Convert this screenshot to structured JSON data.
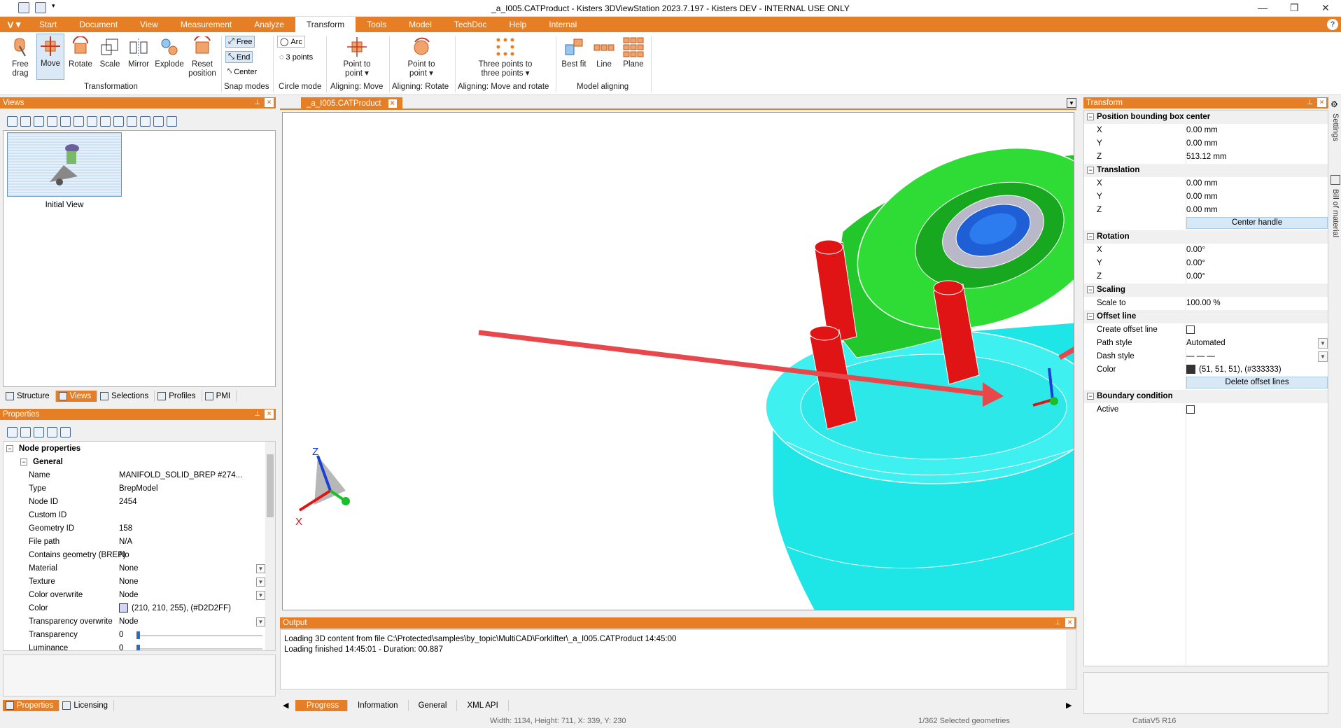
{
  "window": {
    "title": "_a_I005.CATProduct - Kisters 3DViewStation 2023.7.197 - Kisters DEV - INTERNAL USE ONLY",
    "min": "—",
    "max": "❐",
    "close": "✕"
  },
  "menu": {
    "logo": "V",
    "tabs": [
      "Start",
      "Document",
      "View",
      "Measurement",
      "Analyze",
      "Transform",
      "Tools",
      "Model",
      "TechDoc",
      "Help",
      "Internal"
    ],
    "active": "Transform",
    "help": "?"
  },
  "ribbon": {
    "free_drag": "Free drag",
    "move": "Move",
    "rotate": "Rotate",
    "scale": "Scale",
    "mirror": "Mirror",
    "explode": "Explode",
    "reset_position": "Reset position",
    "group_transformation": "Transformation",
    "snap_free": "Free",
    "snap_end": "End",
    "snap_center": "Center",
    "group_snap": "Snap modes",
    "circle_arc": "Arc",
    "circle_3pts": "3 points",
    "group_circle": "Circle mode",
    "p2p_move": "Point to point",
    "group_align_move": "Aligning: Move",
    "p2p_rotate": "Point to point",
    "group_align_rotate": "Aligning: Rotate",
    "three_points": "Three points to three points",
    "group_align_move_rotate": "Aligning: Move and rotate",
    "best_fit": "Best fit",
    "line": "Line",
    "plane": "Plane",
    "group_model_aligning": "Model aligning"
  },
  "views_panel": {
    "title": "Views",
    "thumb_label": "Initial View",
    "tabs": [
      "Structure",
      "Views",
      "Selections",
      "Profiles",
      "PMI"
    ],
    "active_tab": "Views"
  },
  "properties_panel": {
    "title": "Properties",
    "section": "Node properties",
    "subsection": "General",
    "rows": [
      {
        "k": "Name",
        "v": "MANIFOLD_SOLID_BREP #274..."
      },
      {
        "k": "Type",
        "v": "BrepModel"
      },
      {
        "k": "Node ID",
        "v": "2454"
      },
      {
        "k": "Custom ID",
        "v": ""
      },
      {
        "k": "Geometry ID",
        "v": "158"
      },
      {
        "k": "File path",
        "v": "N/A"
      },
      {
        "k": "Contains geometry (BREP)",
        "v": "No"
      },
      {
        "k": "Material",
        "v": "None"
      },
      {
        "k": "Texture",
        "v": "None"
      },
      {
        "k": "Color overwrite",
        "v": "Node"
      },
      {
        "k": "Color",
        "v": "(210, 210, 255), (#D2D2FF)"
      },
      {
        "k": "Transparency overwrite",
        "v": "Node"
      },
      {
        "k": "Transparency",
        "v": "0"
      },
      {
        "k": "Luminance",
        "v": "0"
      }
    ],
    "color_swatch": "#D2D2FF",
    "bottom_tabs": [
      "Properties",
      "Licensing"
    ]
  },
  "doc_tab": {
    "label": "_a_I005.CATProduct"
  },
  "viewport": {
    "axis_x": "X",
    "axis_z": "Z"
  },
  "output_panel": {
    "title": "Output",
    "lines": [
      "Loading 3D content from file C:\\Protected\\samples\\by_topic\\MultiCAD\\Forklifter\\_a_I005.CATProduct 14:45:00",
      "Loading finished 14:45:01 - Duration: 00.887"
    ],
    "tabs": [
      "Progress",
      "Information",
      "General",
      "XML API"
    ],
    "active_tab": "Progress"
  },
  "transform_panel": {
    "title": "Transform",
    "sections": {
      "position": "Position bounding box center",
      "translation": "Translation",
      "rotation": "Rotation",
      "scaling": "Scaling",
      "offset": "Offset line",
      "boundary": "Boundary condition"
    },
    "pos": {
      "x": "0.00 mm",
      "y": "0.00 mm",
      "z": "513.12 mm"
    },
    "trans": {
      "x": "0.00 mm",
      "y": "0.00 mm",
      "z": "0.00 mm"
    },
    "center_handle": "Center handle",
    "rot": {
      "x": "0.00°",
      "y": "0.00°",
      "z": "0.00°"
    },
    "scale_label": "Scale to",
    "scale_value": "100.00 %",
    "create_offset": "Create offset line",
    "path_style": "Path style",
    "path_style_value": "Automated",
    "dash_style": "Dash style",
    "dash_value": "— — —",
    "color": "Color",
    "color_value": "(51, 51, 51), (#333333)",
    "color_swatch": "#333333",
    "delete_offset": "Delete offset lines",
    "active": "Active",
    "labels": {
      "x": "X",
      "y": "Y",
      "z": "Z"
    }
  },
  "side_tabs": [
    "Settings",
    "Bill of material"
  ],
  "status": {
    "dims": "Width: 1134, Height: 711, X: 339, Y: 230",
    "selected": "1/362 Selected geometries",
    "format": "CatiaV5 R16"
  }
}
